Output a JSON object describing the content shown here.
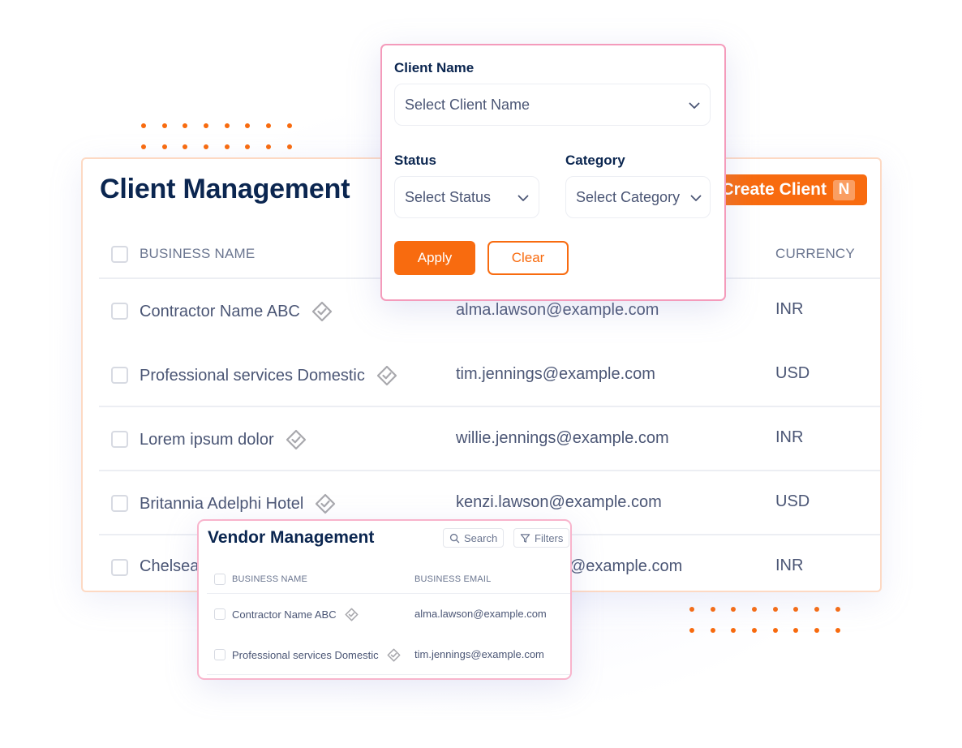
{
  "client_management": {
    "title": "Client Management",
    "create_button": {
      "label": "Create Client",
      "shortcut": "N"
    },
    "columns": {
      "business_name": "BUSINESS NAME",
      "currency": "CURRENCY"
    },
    "rows": [
      {
        "business_name": "Contractor Name ABC",
        "verified": true,
        "email": "alma.lawson@example.com",
        "currency": "INR"
      },
      {
        "business_name": "Professional services Domestic",
        "verified": true,
        "email": "tim.jennings@example.com",
        "currency": "USD"
      },
      {
        "business_name": "Lorem ipsum dolor",
        "verified": true,
        "email": "willie.jennings@example.com",
        "currency": "INR"
      },
      {
        "business_name": "Britannia Adelphi Hotel",
        "verified": true,
        "email": "kenzi.lawson@example.com",
        "currency": "USD"
      },
      {
        "business_name": "Chelsea",
        "verified": false,
        "email": "@example.com",
        "currency": "INR"
      }
    ]
  },
  "filter_popover": {
    "client_name": {
      "label": "Client Name",
      "placeholder": "Select Client Name"
    },
    "status": {
      "label": "Status",
      "placeholder": "Select Status"
    },
    "category": {
      "label": "Category",
      "placeholder": "Select Category"
    },
    "apply_label": "Apply",
    "clear_label": "Clear"
  },
  "vendor_management": {
    "title": "Vendor Management",
    "search_label": "Search",
    "filters_label": "Filters",
    "columns": {
      "business_name": "BUSINESS NAME",
      "business_email": "BUSINESS EMAIL"
    },
    "rows": [
      {
        "business_name": "Contractor Name ABC",
        "verified": true,
        "email": "alma.lawson@example.com"
      },
      {
        "business_name": "Professional services Domestic",
        "verified": true,
        "email": "tim.jennings@example.com"
      }
    ]
  },
  "colors": {
    "accent": "#f86b0f",
    "heading": "#0b2650",
    "body_text": "#4b5675",
    "popover_border": "#f49bbb",
    "card_border": "#fdd9c3"
  }
}
